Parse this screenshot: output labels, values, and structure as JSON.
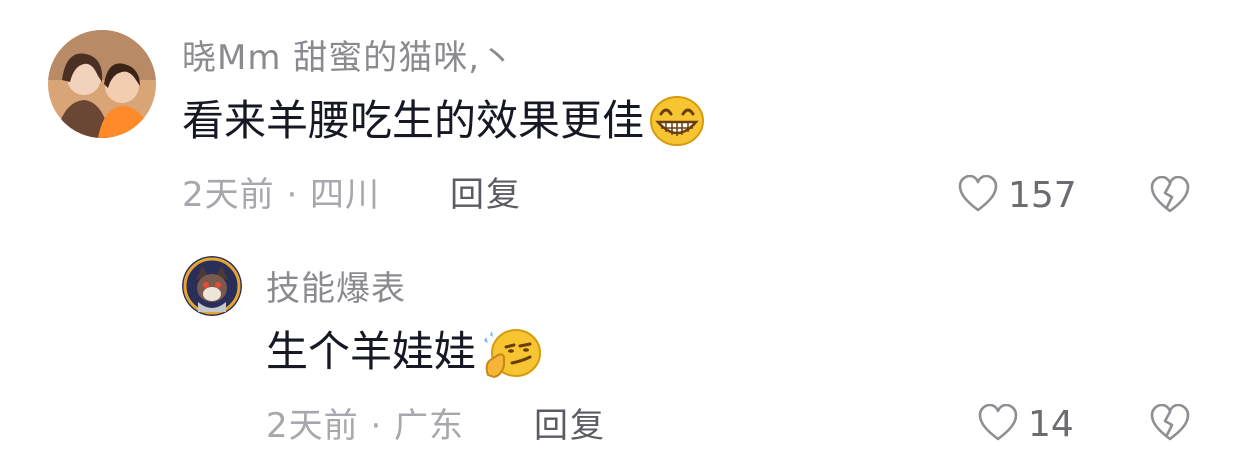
{
  "comments": [
    {
      "username": "晓Mm  甜蜜的猫咪,丶",
      "text": "看来羊腰吃生的效果更佳",
      "emoji": "grinning-face-emoji",
      "time_location": "2天前 · 四川",
      "reply_label": "回复",
      "likes": "157"
    },
    {
      "username": "技能爆表",
      "text": "生个羊娃娃",
      "emoji": "smirk-snap-emoji",
      "time_location": "2天前 · 广东",
      "reply_label": "回复",
      "likes": "14"
    }
  ],
  "colors": {
    "username": "#8a8b91",
    "meta": "#a7a8ad",
    "text": "#161823",
    "icon": "#8e8f95",
    "emoji_yellow": "#f7c531"
  }
}
